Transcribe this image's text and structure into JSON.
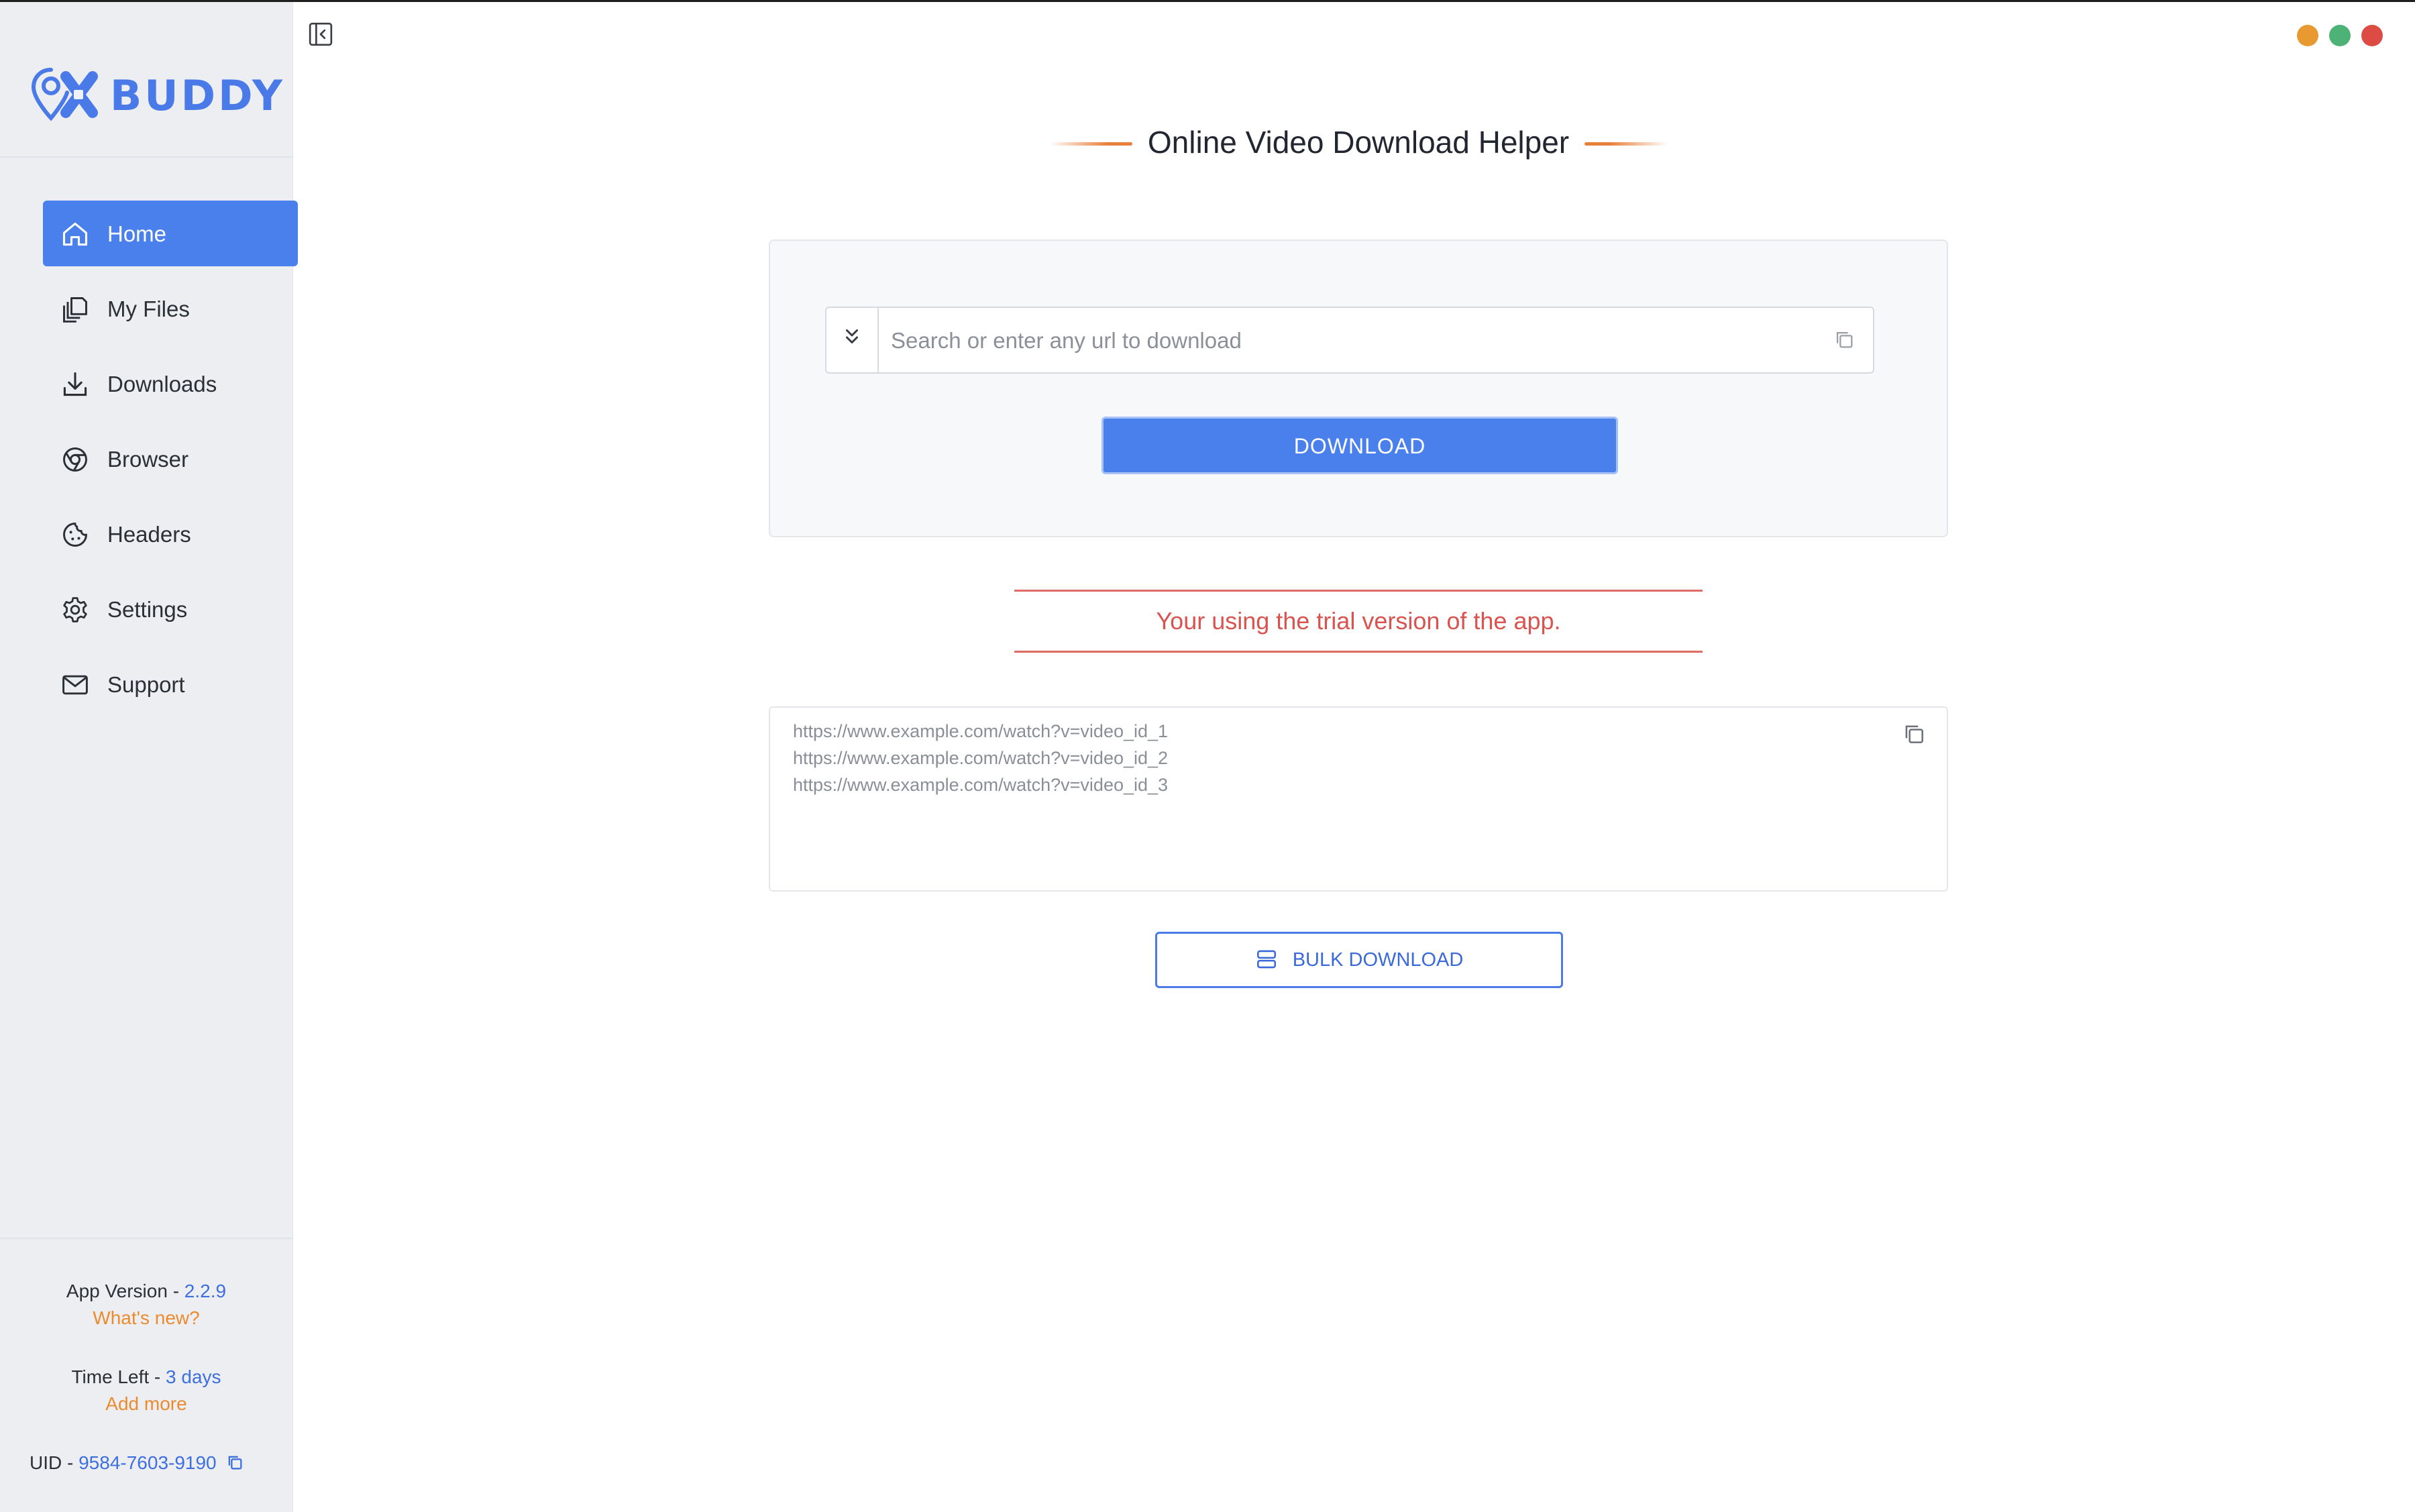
{
  "app": {
    "logo_text": "BUDDY",
    "logo_mark": "9X"
  },
  "colors": {
    "accent": "#4a80ec",
    "orange": "#ec8a2e",
    "error": "#d9534f",
    "sidebar_bg": "#eceef2"
  },
  "sidebar": {
    "items": [
      {
        "label": "Home",
        "icon": "home-icon",
        "active": true
      },
      {
        "label": "My Files",
        "icon": "files-icon",
        "active": false
      },
      {
        "label": "Downloads",
        "icon": "download-icon",
        "active": false
      },
      {
        "label": "Browser",
        "icon": "browser-icon",
        "active": false
      },
      {
        "label": "Headers",
        "icon": "cookie-icon",
        "active": false
      },
      {
        "label": "Settings",
        "icon": "gear-icon",
        "active": false
      },
      {
        "label": "Support",
        "icon": "mail-icon",
        "active": false
      }
    ],
    "footer": {
      "version_label": "App Version - ",
      "version_value": "2.2.9",
      "whats_new": "What's new?",
      "time_left_label": "Time Left - ",
      "time_left_value": "3 days",
      "add_more": "Add more",
      "uid_label": "UID - ",
      "uid_value": "9584-7603-9190"
    }
  },
  "window": {
    "traffic_lights": [
      "#e89a30",
      "#4cb275",
      "#dd4b45"
    ]
  },
  "main": {
    "title": "Online Video Download Helper",
    "search": {
      "placeholder": "Search or enter any url to download",
      "value": ""
    },
    "download_label": "DOWNLOAD",
    "trial_message": "Your using the trial version of the app.",
    "bulk_urls": [
      "https://www.example.com/watch?v=video_id_1",
      "https://www.example.com/watch?v=video_id_2",
      "https://www.example.com/watch?v=video_id_3"
    ],
    "bulk_download_label": "BULK DOWNLOAD"
  }
}
